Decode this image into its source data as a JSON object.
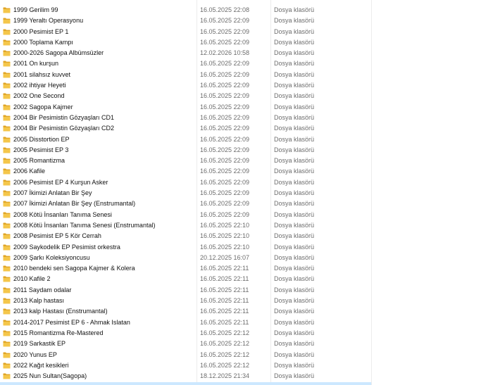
{
  "columns": [
    "name",
    "date",
    "type"
  ],
  "folder_icon": "folder-icon",
  "colors": {
    "folder_front": "#f4c64a",
    "folder_back": "#e0a526",
    "selection": "#cce8ff",
    "secondary_text": "#6d6d6d"
  },
  "rows": [
    {
      "name": "1999 Gerilim 99",
      "date": "16.05.2025 22:08",
      "type": "Dosya klasörü"
    },
    {
      "name": "1999 Yeraltı Operasyonu",
      "date": "16.05.2025 22:09",
      "type": "Dosya klasörü"
    },
    {
      "name": "2000 Pesimist EP 1",
      "date": "16.05.2025 22:09",
      "type": "Dosya klasörü"
    },
    {
      "name": "2000 Toplama Kampı",
      "date": "16.05.2025 22:09",
      "type": "Dosya klasörü"
    },
    {
      "name": "2000-2026 Sagopa Albümsüzler",
      "date": "12.02.2026 10:58",
      "type": "Dosya klasörü"
    },
    {
      "name": "2001 On kurşun",
      "date": "16.05.2025 22:09",
      "type": "Dosya klasörü"
    },
    {
      "name": "2001 silahsız kuvvet",
      "date": "16.05.2025 22:09",
      "type": "Dosya klasörü"
    },
    {
      "name": "2002 ihtiyar Heyeti",
      "date": "16.05.2025 22:09",
      "type": "Dosya klasörü"
    },
    {
      "name": "2002 One Second",
      "date": "16.05.2025 22:09",
      "type": "Dosya klasörü"
    },
    {
      "name": "2002 Sagopa Kajmer",
      "date": "16.05.2025 22:09",
      "type": "Dosya klasörü"
    },
    {
      "name": "2004 Bir Pesimistin Gözyaşları CD1",
      "date": "16.05.2025 22:09",
      "type": "Dosya klasörü"
    },
    {
      "name": "2004 Bir Pesimistin Gözyaşları CD2",
      "date": "16.05.2025 22:09",
      "type": "Dosya klasörü"
    },
    {
      "name": "2005 Disstortion EP",
      "date": "16.05.2025 22:09",
      "type": "Dosya klasörü"
    },
    {
      "name": "2005 Pesimist EP 3",
      "date": "16.05.2025 22:09",
      "type": "Dosya klasörü"
    },
    {
      "name": "2005 Romantizma",
      "date": "16.05.2025 22:09",
      "type": "Dosya klasörü"
    },
    {
      "name": "2006 Kafile",
      "date": "16.05.2025 22:09",
      "type": "Dosya klasörü"
    },
    {
      "name": "2006 Pesimist EP 4 Kurşun Asker",
      "date": "16.05.2025 22:09",
      "type": "Dosya klasörü"
    },
    {
      "name": "2007 İkimizi Anlatan Bir Şey",
      "date": "16.05.2025 22:09",
      "type": "Dosya klasörü"
    },
    {
      "name": "2007 İkimizi Anlatan Bir Şey (Enstrumantal)",
      "date": "16.05.2025 22:09",
      "type": "Dosya klasörü"
    },
    {
      "name": "2008 Kötü İnsanları Tanıma Senesi",
      "date": "16.05.2025 22:09",
      "type": "Dosya klasörü"
    },
    {
      "name": "2008 Kötü İnsanları Tanıma Senesi (Enstrumantal)",
      "date": "16.05.2025 22:10",
      "type": "Dosya klasörü"
    },
    {
      "name": "2008 Pesimist EP 5 Kör Cerrah",
      "date": "16.05.2025 22:10",
      "type": "Dosya klasörü"
    },
    {
      "name": "2009 Saykodelik EP Pesimist orkestra",
      "date": "16.05.2025 22:10",
      "type": "Dosya klasörü"
    },
    {
      "name": "2009 Şarkı Koleksiyoncusu",
      "date": "20.12.2025 16:07",
      "type": "Dosya klasörü"
    },
    {
      "name": "2010 bendeki sen Sagopa Kajmer & Kolera",
      "date": "16.05.2025 22:11",
      "type": "Dosya klasörü"
    },
    {
      "name": "2010 Kafile 2",
      "date": "16.05.2025 22:11",
      "type": "Dosya klasörü"
    },
    {
      "name": "2011 Saydam odalar",
      "date": "16.05.2025 22:11",
      "type": "Dosya klasörü"
    },
    {
      "name": "2013 Kalp hastası",
      "date": "16.05.2025 22:11",
      "type": "Dosya klasörü"
    },
    {
      "name": "2013 kalp Hastası (Enstrumantal)",
      "date": "16.05.2025 22:11",
      "type": "Dosya klasörü"
    },
    {
      "name": "2014-2017 Pesimist EP 6 - Ahmak Islatan",
      "date": "16.05.2025 22:11",
      "type": "Dosya klasörü"
    },
    {
      "name": "2015 Romantizma Re-Mastered",
      "date": "16.05.2025 22:12",
      "type": "Dosya klasörü"
    },
    {
      "name": "2019 Sarkastik EP",
      "date": "16.05.2025 22:12",
      "type": "Dosya klasörü"
    },
    {
      "name": "2020 Yunus EP",
      "date": "16.05.2025 22:12",
      "type": "Dosya klasörü"
    },
    {
      "name": "2022 Kağıt kesikleri",
      "date": "16.05.2025 22:12",
      "type": "Dosya klasörü"
    },
    {
      "name": "2025 Nun Sultan(Sagopa)",
      "date": "18.12.2025 21:34",
      "type": "Dosya klasörü"
    }
  ]
}
